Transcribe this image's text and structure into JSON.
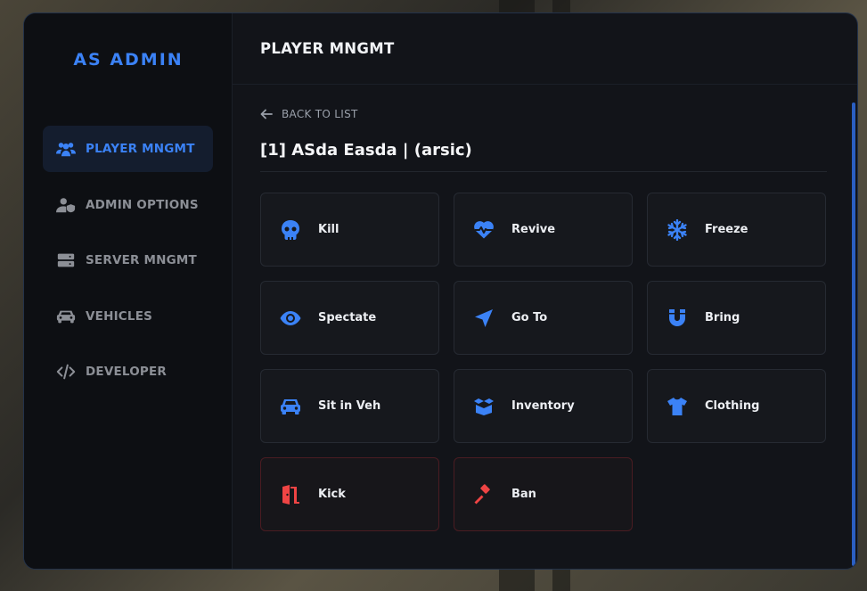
{
  "app": {
    "brand": "AS ADMIN"
  },
  "sidebar": {
    "items": [
      {
        "label": "PLAYER MNGMT",
        "icon": "users-icon",
        "active": true
      },
      {
        "label": "ADMIN OPTIONS",
        "icon": "user-shield-icon",
        "active": false
      },
      {
        "label": "SERVER MNGMT",
        "icon": "server-icon",
        "active": false
      },
      {
        "label": "VEHICLES",
        "icon": "car-icon",
        "active": false
      },
      {
        "label": "DEVELOPER",
        "icon": "code-icon",
        "active": false
      }
    ]
  },
  "header": {
    "title": "PLAYER MNGMT"
  },
  "player": {
    "back_label": "BACK TO LIST",
    "title": "[1] ASda Easda | (arsic)"
  },
  "actions": [
    {
      "label": "Kill",
      "icon": "skull-icon",
      "danger": false
    },
    {
      "label": "Revive",
      "icon": "heart-pulse-icon",
      "danger": false
    },
    {
      "label": "Freeze",
      "icon": "snowflake-icon",
      "danger": false
    },
    {
      "label": "Spectate",
      "icon": "eye-icon",
      "danger": false
    },
    {
      "label": "Go To",
      "icon": "location-arrow-icon",
      "danger": false
    },
    {
      "label": "Bring",
      "icon": "magnet-icon",
      "danger": false
    },
    {
      "label": "Sit in Veh",
      "icon": "car-icon",
      "danger": false
    },
    {
      "label": "Inventory",
      "icon": "box-open-icon",
      "danger": false
    },
    {
      "label": "Clothing",
      "icon": "shirt-icon",
      "danger": false
    },
    {
      "label": "Kick",
      "icon": "door-open-icon",
      "danger": true
    },
    {
      "label": "Ban",
      "icon": "gavel-icon",
      "danger": true
    }
  ],
  "colors": {
    "accent": "#3b82f6",
    "danger": "#ef4444",
    "panel_bg": "#121419",
    "sidebar_bg": "#0d0f13"
  }
}
